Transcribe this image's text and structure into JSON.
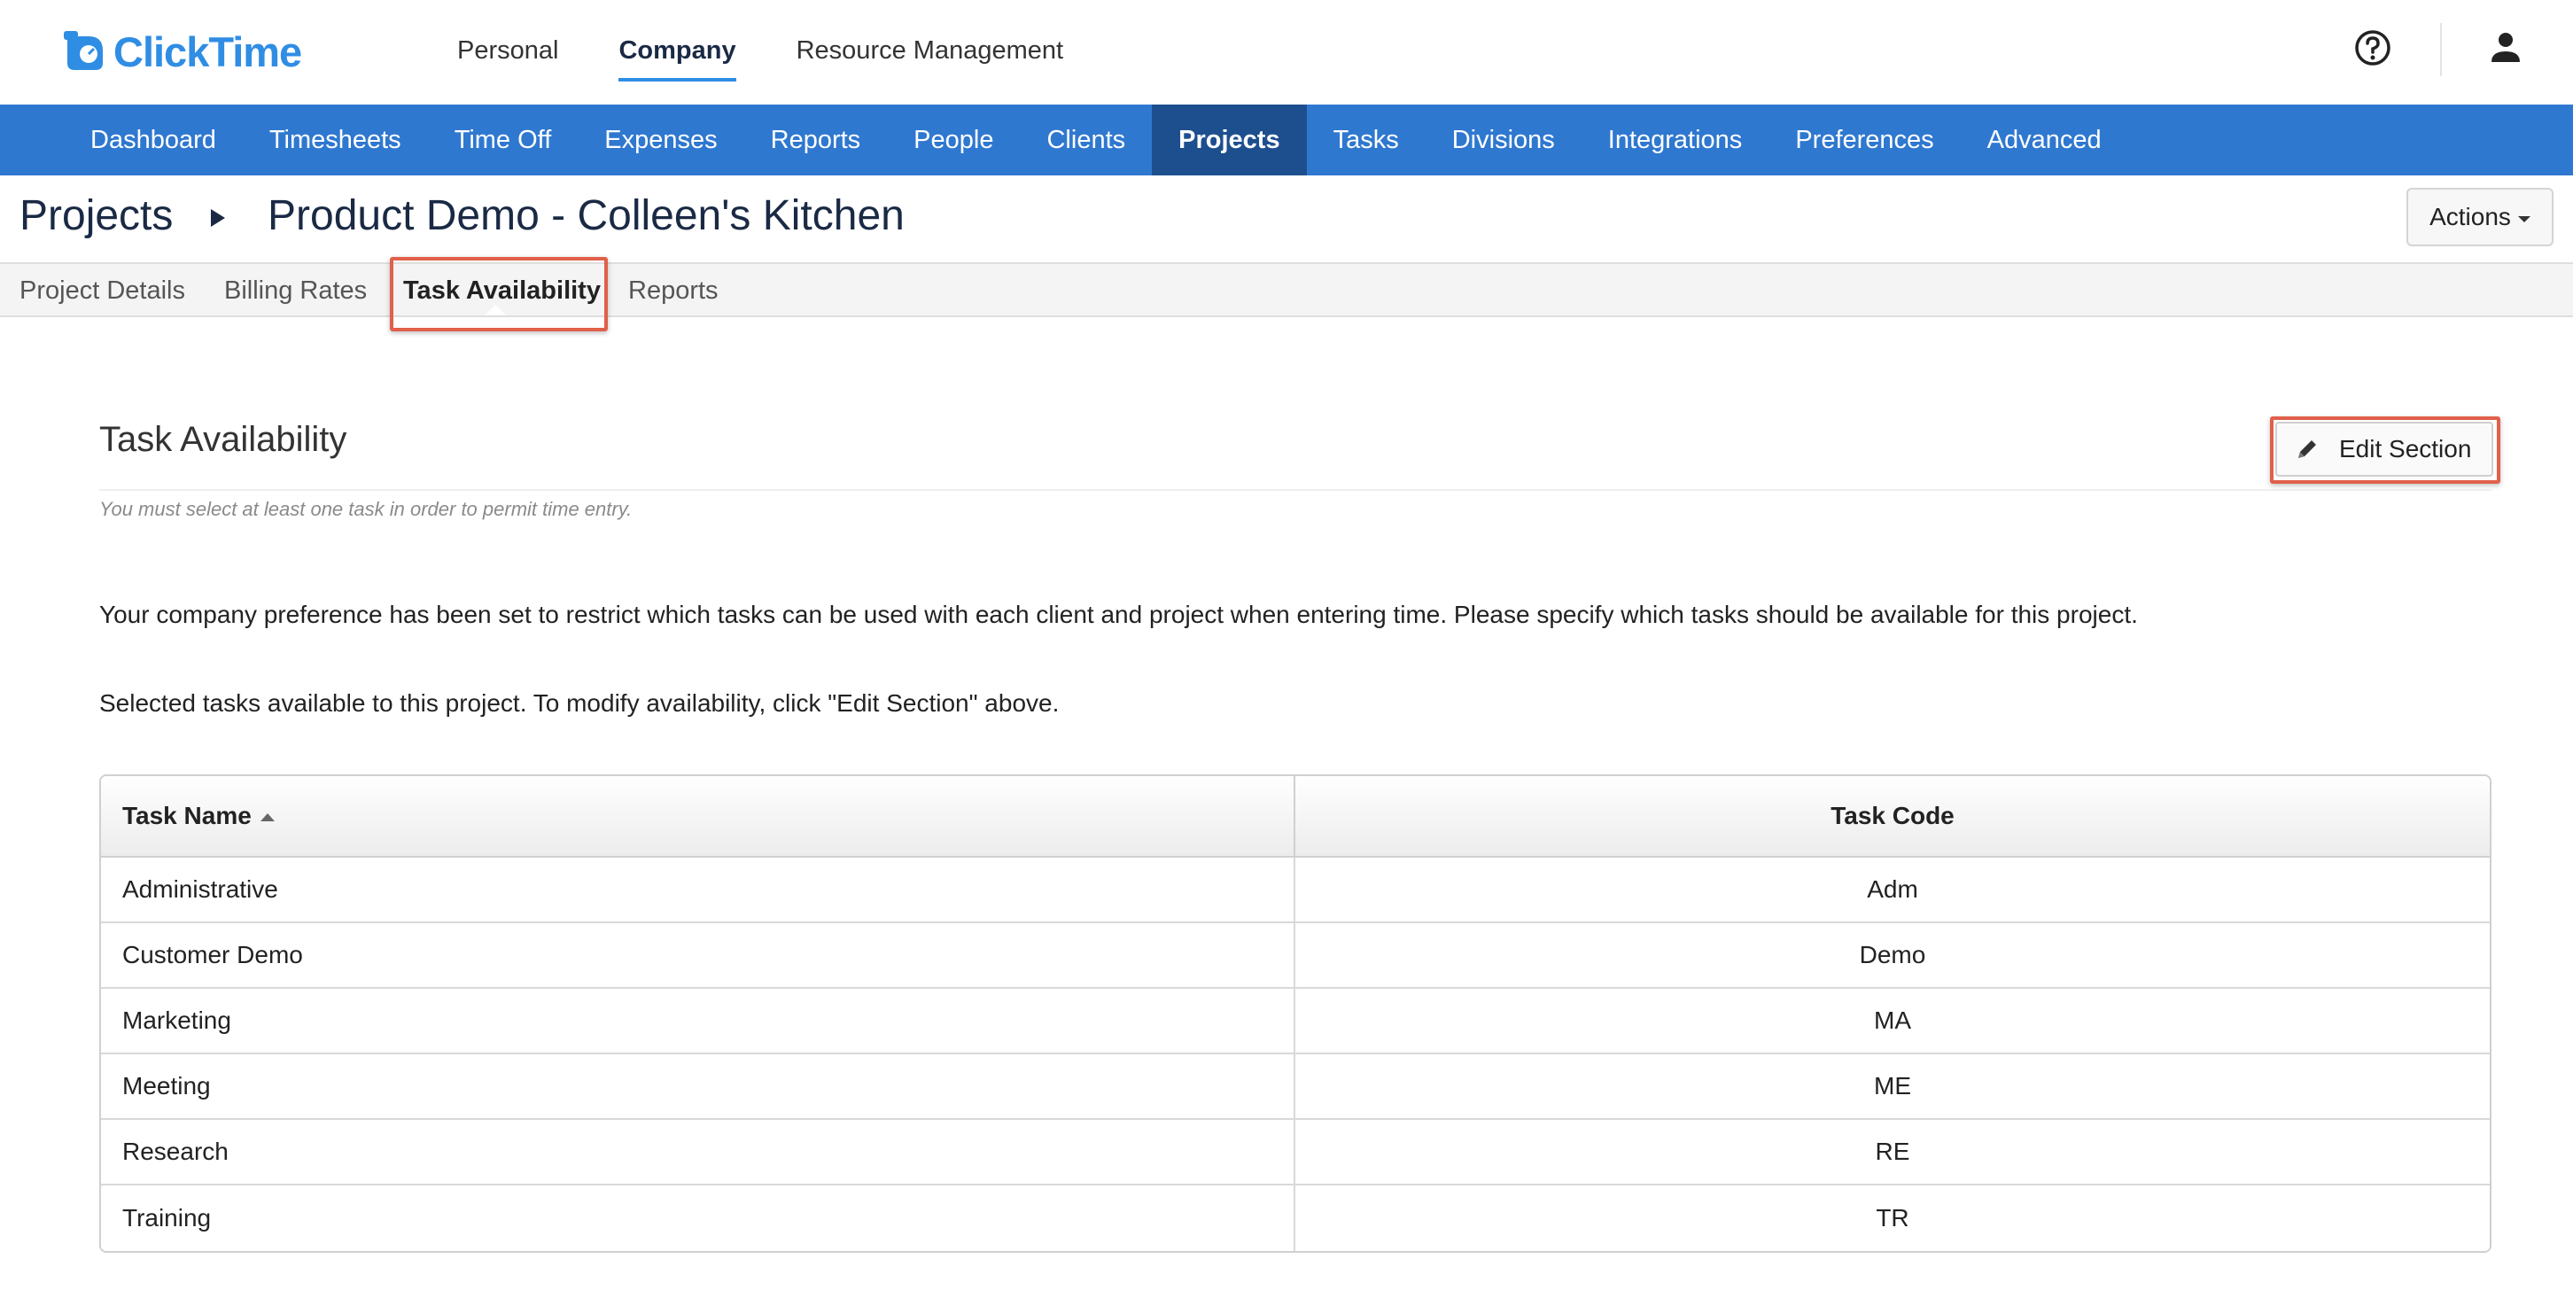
{
  "brand": {
    "name": "ClickTime",
    "color": "#2f8de4"
  },
  "top_nav": [
    {
      "label": "Personal",
      "active": false
    },
    {
      "label": "Company",
      "active": true
    },
    {
      "label": "Resource Management",
      "active": false
    }
  ],
  "header_icons": {
    "help": "help-circle-icon",
    "user": "user-icon"
  },
  "main_nav": {
    "items": [
      "Dashboard",
      "Timesheets",
      "Time Off",
      "Expenses",
      "Reports",
      "People",
      "Clients",
      "Projects",
      "Tasks",
      "Divisions",
      "Integrations",
      "Preferences",
      "Advanced"
    ],
    "active": "Projects",
    "bar_color": "#2f78d0",
    "active_color": "#1d4f8f"
  },
  "breadcrumb": {
    "root": "Projects",
    "current": "Product Demo - Colleen's Kitchen"
  },
  "actions_label": "Actions",
  "sub_tabs": [
    {
      "label": "Project Details",
      "active": false
    },
    {
      "label": "Billing Rates",
      "active": false
    },
    {
      "label": "Task Availability",
      "active": true
    },
    {
      "label": "Reports",
      "active": false
    }
  ],
  "section": {
    "title": "Task Availability",
    "hint": "You must select at least one task in order to permit time entry.",
    "edit_label": "Edit Section",
    "description": "Your company preference has been set to restrict which tasks can be used with each client and project when entering time. Please specify which tasks should be available for this project.",
    "instruction": "Selected tasks available to this project. To modify availability, click \"Edit Section\" above."
  },
  "highlight_color": "#e0604a",
  "table": {
    "columns": {
      "name": "Task Name",
      "code": "Task Code"
    },
    "rows": [
      {
        "name": "Administrative",
        "code": "Adm"
      },
      {
        "name": "Customer Demo",
        "code": "Demo"
      },
      {
        "name": "Marketing",
        "code": "MA"
      },
      {
        "name": "Meeting",
        "code": "ME"
      },
      {
        "name": "Research",
        "code": "RE"
      },
      {
        "name": "Training",
        "code": "TR"
      }
    ]
  }
}
